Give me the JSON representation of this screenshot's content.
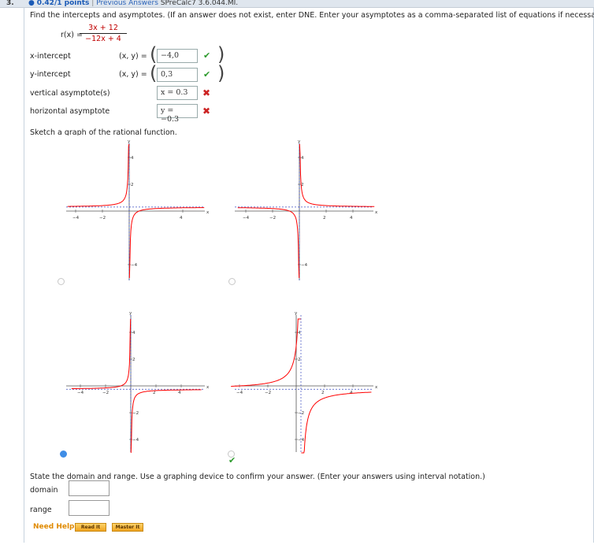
{
  "question": {
    "number": "3.",
    "points": "0.42/1 points",
    "separator": "|",
    "previous_answers": "Previous Answers",
    "problem_id": "SPreCalc7 3.6.044.MI.",
    "instructions": "Find the intercepts and asymptotes. (If an answer does not exist, enter DNE. Enter your asymptotes as a comma-separated list of equations if necessary.)",
    "function_label": "r(x) =",
    "numerator": "3x + 12",
    "denominator": "−12x + 4"
  },
  "answers": [
    {
      "label": "x-intercept",
      "prefix": "(x, y) =",
      "value": "−4,0",
      "status": "correct"
    },
    {
      "label": "y-intercept",
      "prefix": "(x, y) =",
      "value": "0,3",
      "status": "correct"
    },
    {
      "label": "vertical asymptote(s)",
      "prefix": "",
      "value": "x = 0.3",
      "status": "incorrect"
    },
    {
      "label": "horizontal asymptote",
      "prefix": "",
      "value": "y = −0.3",
      "status": "incorrect"
    }
  ],
  "sketch_prompt": "Sketch a graph of the rational function.",
  "graphs": [
    {
      "selected": false,
      "yticks": [
        "4",
        "2",
        "−4"
      ],
      "xticks": [
        "−4",
        "−2",
        "4"
      ]
    },
    {
      "selected": false,
      "yticks": [
        "4",
        "2",
        "−4"
      ],
      "xticks": [
        "−4",
        "−2",
        "2",
        "4"
      ]
    },
    {
      "selected": true,
      "yticks": [
        "4",
        "2",
        "−2",
        "−4"
      ],
      "xticks": [
        "−4",
        "−2",
        "2",
        "4"
      ]
    },
    {
      "selected": false,
      "yticks": [
        "4",
        "2",
        "−2",
        "−4"
      ],
      "xticks": [
        "−4",
        "−2",
        "2",
        "4"
      ]
    }
  ],
  "axis_labels": {
    "x": "x",
    "y": "y"
  },
  "domain_prompt": "State the domain and range. Use a graphing device to confirm your answer. (Enter your answers using interval notation.)",
  "domain_label": "domain",
  "range_label": "range",
  "need_help": "Need Help?",
  "read_it": "Read It",
  "master_it": "Master It",
  "colors": {
    "curve": "#ff0000",
    "asymptote": "#3b4cc0",
    "correct": "#2c9a2c",
    "incorrect": "#cc2222",
    "selected_radio": "#3f8de6"
  }
}
